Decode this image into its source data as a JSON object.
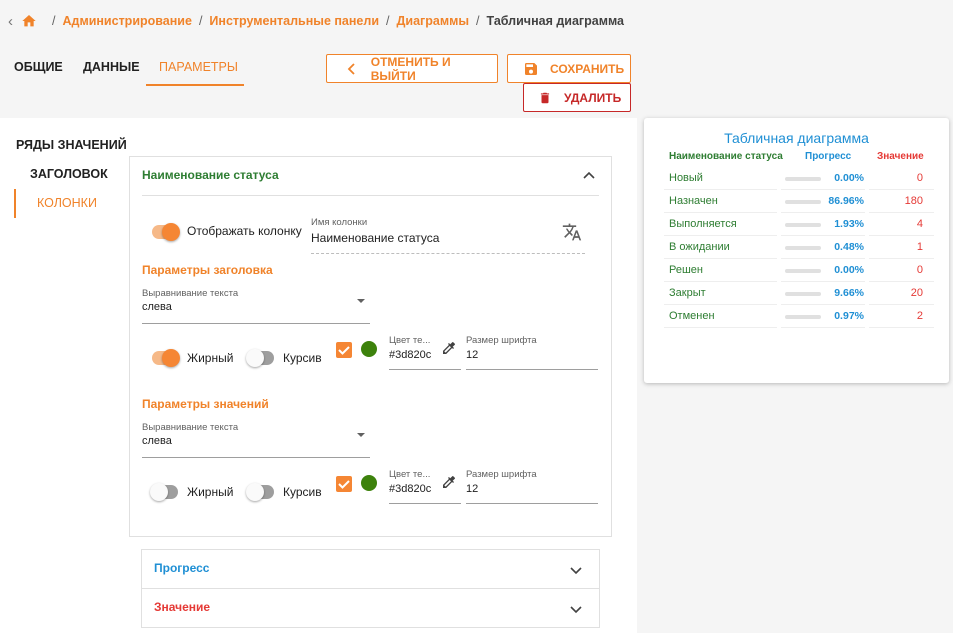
{
  "breadcrumb": {
    "items": [
      "Администрирование",
      "Инструментальные панели",
      "Диаграммы"
    ],
    "current": "Табличная диаграмма"
  },
  "tabs": [
    "ОБЩИЕ",
    "ДАННЫЕ",
    "ПАРАМЕТРЫ"
  ],
  "actions": {
    "cancel": "ОТМЕНИТЬ И ВЫЙТИ",
    "save": "СОХРАНИТЬ",
    "delete": "УДАЛИТЬ"
  },
  "sidenav": [
    "РЯДЫ ЗНАЧЕНИЙ",
    "ЗАГОЛОВОК",
    "КОЛОНКИ"
  ],
  "column_panel": {
    "title": "Наименование статуса",
    "show_column_label": "Отображать колонку",
    "column_name_label": "Имя колонки",
    "column_name_value": "Наименование статуса",
    "header_params": {
      "title": "Параметры заголовка",
      "align_label": "Выравнивание текста",
      "align_value": "слева",
      "bold_label": "Жирный",
      "italic_label": "Курсив",
      "color_label": "Цвет те...",
      "color_value": "#3d820c",
      "font_size_label": "Размер шрифта",
      "font_size_value": "12"
    },
    "value_params": {
      "title": "Параметры значений",
      "align_label": "Выравнивание текста",
      "align_value": "слева",
      "bold_label": "Жирный",
      "italic_label": "Курсив",
      "color_label": "Цвет те...",
      "color_value": "#3d820c",
      "font_size_label": "Размер шрифта",
      "font_size_value": "12"
    }
  },
  "collapsed_panels": [
    {
      "title": "Прогресс",
      "color": "#1f8fd4"
    },
    {
      "title": "Значение",
      "color": "#e53935"
    }
  ],
  "preview": {
    "title": "Табличная диаграмма",
    "headers": [
      "Наименование статуса",
      "Прогресс",
      "Значение"
    ],
    "rows": [
      {
        "name": "Новый",
        "progress": "0.00%",
        "fraction": 0.0,
        "value": "0"
      },
      {
        "name": "Назначен",
        "progress": "86.96%",
        "fraction": 0.8696,
        "value": "180"
      },
      {
        "name": "Выполняется",
        "progress": "1.93%",
        "fraction": 0.0193,
        "value": "4"
      },
      {
        "name": "В ожидании",
        "progress": "0.48%",
        "fraction": 0.0048,
        "value": "1"
      },
      {
        "name": "Решен",
        "progress": "0.00%",
        "fraction": 0.0,
        "value": "0"
      },
      {
        "name": "Закрыт",
        "progress": "9.66%",
        "fraction": 0.0966,
        "value": "20"
      },
      {
        "name": "Отменен",
        "progress": "0.97%",
        "fraction": 0.0097,
        "value": "2"
      }
    ]
  },
  "colors": {
    "accent": "#f0832a",
    "danger": "#c62828",
    "green": "#2e7d32",
    "blue": "#1f8fd4",
    "red": "#e53935"
  }
}
